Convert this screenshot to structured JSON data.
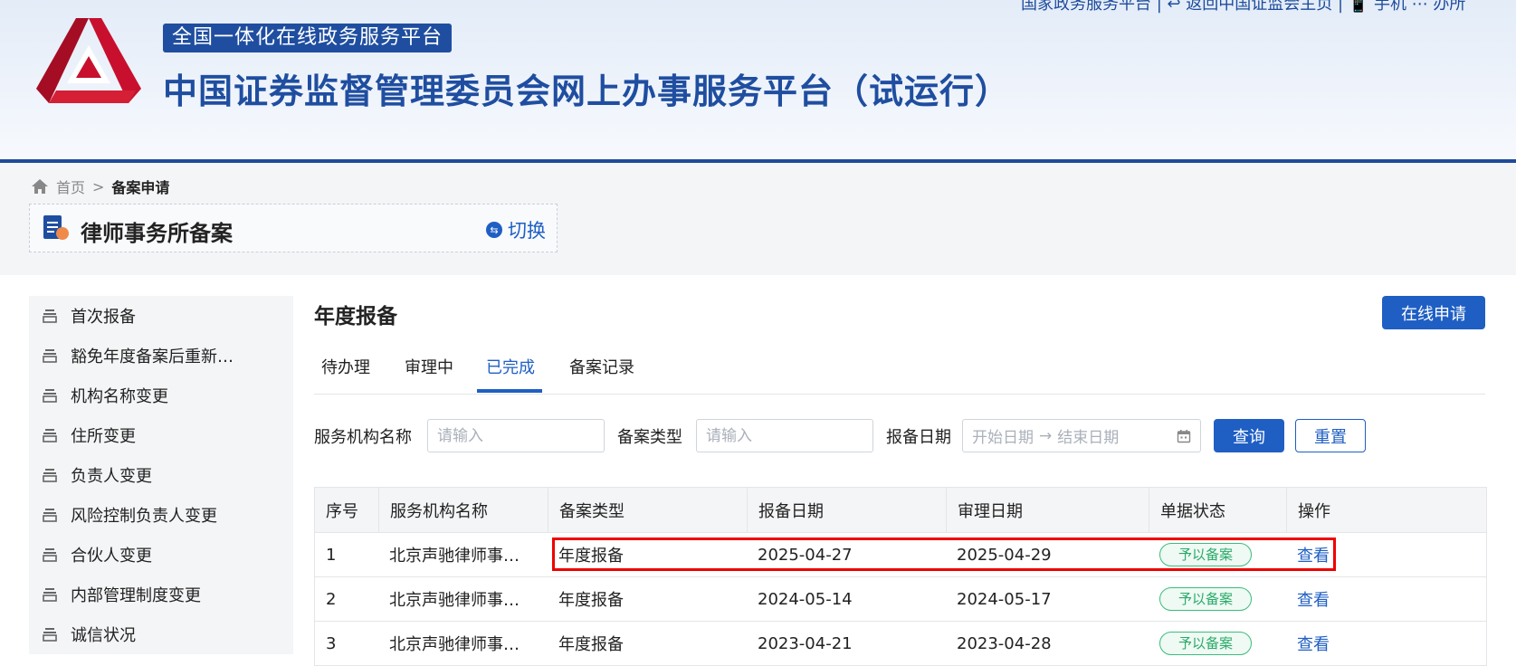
{
  "header": {
    "top_links": "国家政务服务平台 | ↩ 返回中国证监会主页 | 📱 手机 ⋯ 办所",
    "badge": "全国一体化在线政务服务平台",
    "site_title": "中国证券监督管理委员会网上办事服务平台（试运行）",
    "brand_color": "#1f4ea0"
  },
  "breadcrumb": {
    "home": "首页",
    "separator": ">",
    "current": "备案申请"
  },
  "switcher": {
    "name": "律师事务所备案",
    "toggle_label": "切换"
  },
  "sidebar": {
    "items": [
      {
        "label": "首次报备"
      },
      {
        "label": "豁免年度备案后重新…"
      },
      {
        "label": "机构名称变更"
      },
      {
        "label": "住所变更"
      },
      {
        "label": "负责人变更"
      },
      {
        "label": "风险控制负责人变更"
      },
      {
        "label": "合伙人变更"
      },
      {
        "label": "内部管理制度变更"
      },
      {
        "label": "诚信状况"
      }
    ]
  },
  "main": {
    "title": "年度报备",
    "apply_label": "在线申请",
    "tabs": [
      {
        "label": "待办理"
      },
      {
        "label": "审理中"
      },
      {
        "label": "已完成"
      },
      {
        "label": "备案记录"
      }
    ],
    "active_tab": "已完成"
  },
  "filters": {
    "org_label": "服务机构名称",
    "org_placeholder": "请输入",
    "type_label": "备案类型",
    "type_placeholder": "请输入",
    "date_label": "报备日期",
    "date_start": "开始日期",
    "date_arrow": "→",
    "date_end": "结束日期",
    "query_label": "查询",
    "reset_label": "重置"
  },
  "table": {
    "headers": [
      "序号",
      "服务机构名称",
      "备案类型",
      "报备日期",
      "审理日期",
      "单据状态",
      "操作"
    ],
    "rows": [
      {
        "no": "1",
        "org": "北京声驰律师事…",
        "type": "年度报备",
        "report_date": "2025-04-27",
        "review_date": "2025-04-29",
        "status": "予以备案",
        "action": "查看"
      },
      {
        "no": "2",
        "org": "北京声驰律师事…",
        "type": "年度报备",
        "report_date": "2024-05-14",
        "review_date": "2024-05-17",
        "status": "予以备案",
        "action": "查看"
      },
      {
        "no": "3",
        "org": "北京声驰律师事…",
        "type": "年度报备",
        "report_date": "2023-04-21",
        "review_date": "2023-04-28",
        "status": "予以备案",
        "action": "查看"
      }
    ],
    "highlight_color": "#e00000"
  }
}
